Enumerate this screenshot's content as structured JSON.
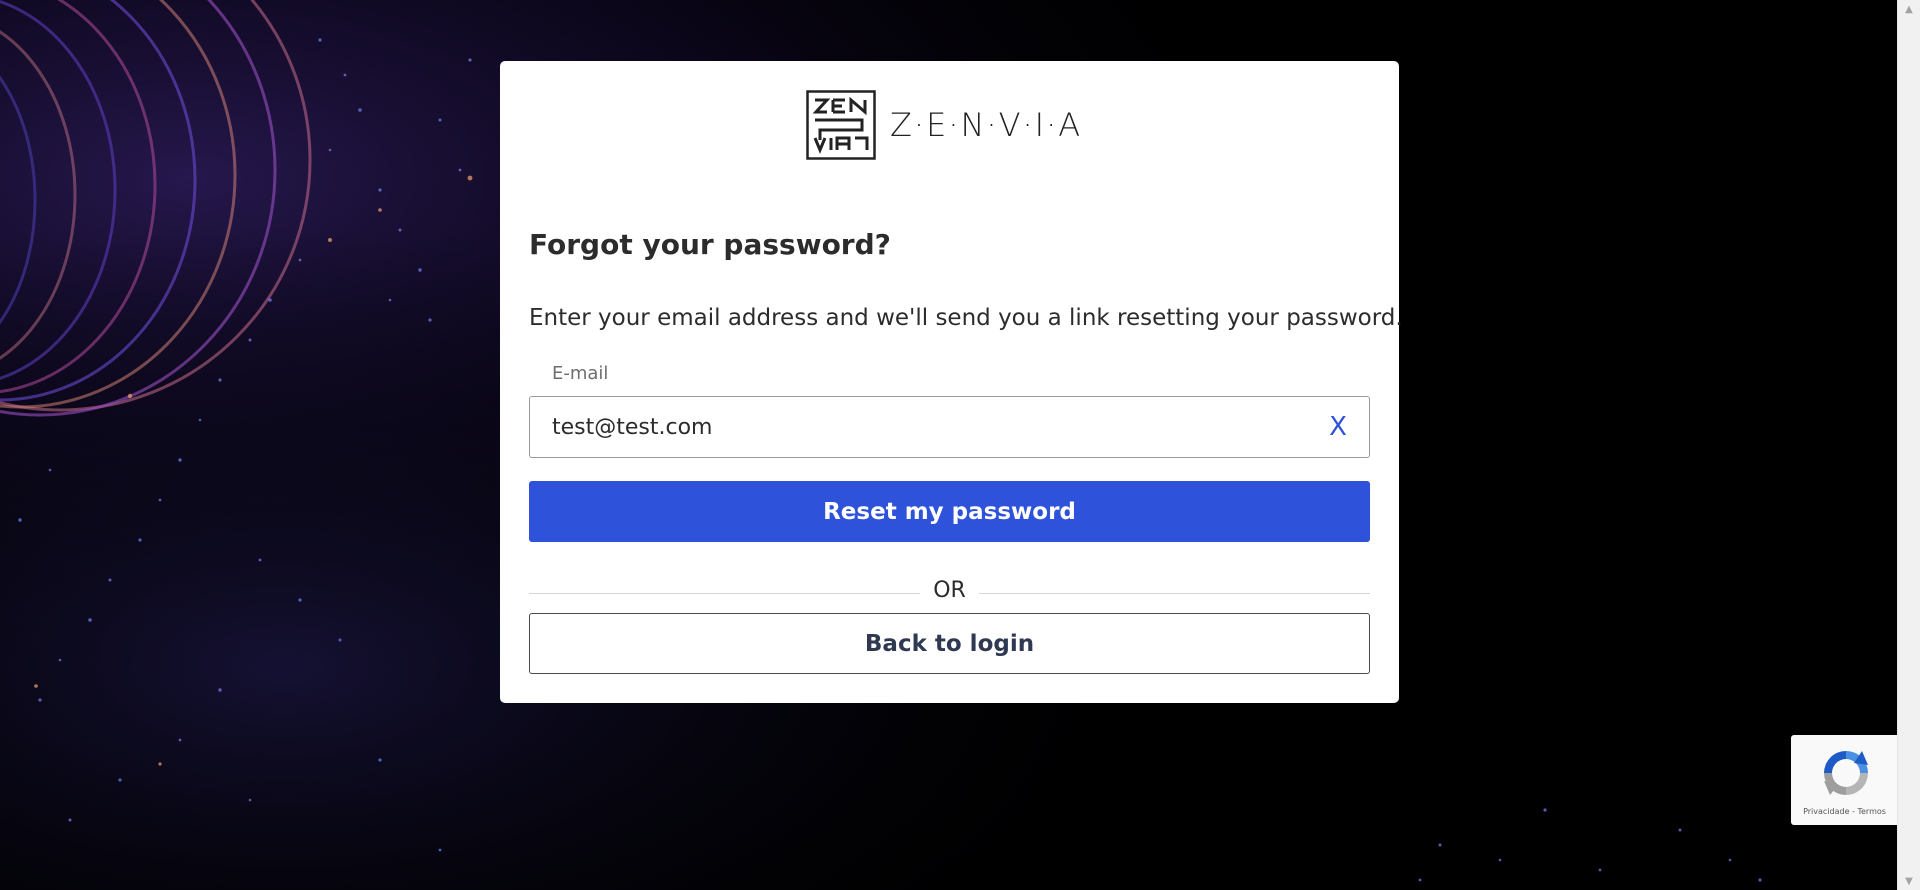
{
  "brand": {
    "name": "Z·E·N·V·I·A"
  },
  "form": {
    "title": "Forgot your password?",
    "subtitle": "Enter your email address and we'll send you a link resetting your password.",
    "email_label": "E-mail",
    "email_value": "test@test.com",
    "clear_label": "X",
    "submit_label": "Reset my password",
    "divider_label": "OR",
    "back_label": "Back to login"
  },
  "recaptcha": {
    "privacy_label": "Privacidade",
    "separator": " - ",
    "terms_label": "Termos"
  },
  "colors": {
    "accent": "#2f52db",
    "background": "#000000",
    "card": "#ffffff"
  },
  "icons": {
    "logo": "zenvia-logo-icon",
    "clear": "close-icon",
    "recaptcha": "recaptcha-icon"
  }
}
